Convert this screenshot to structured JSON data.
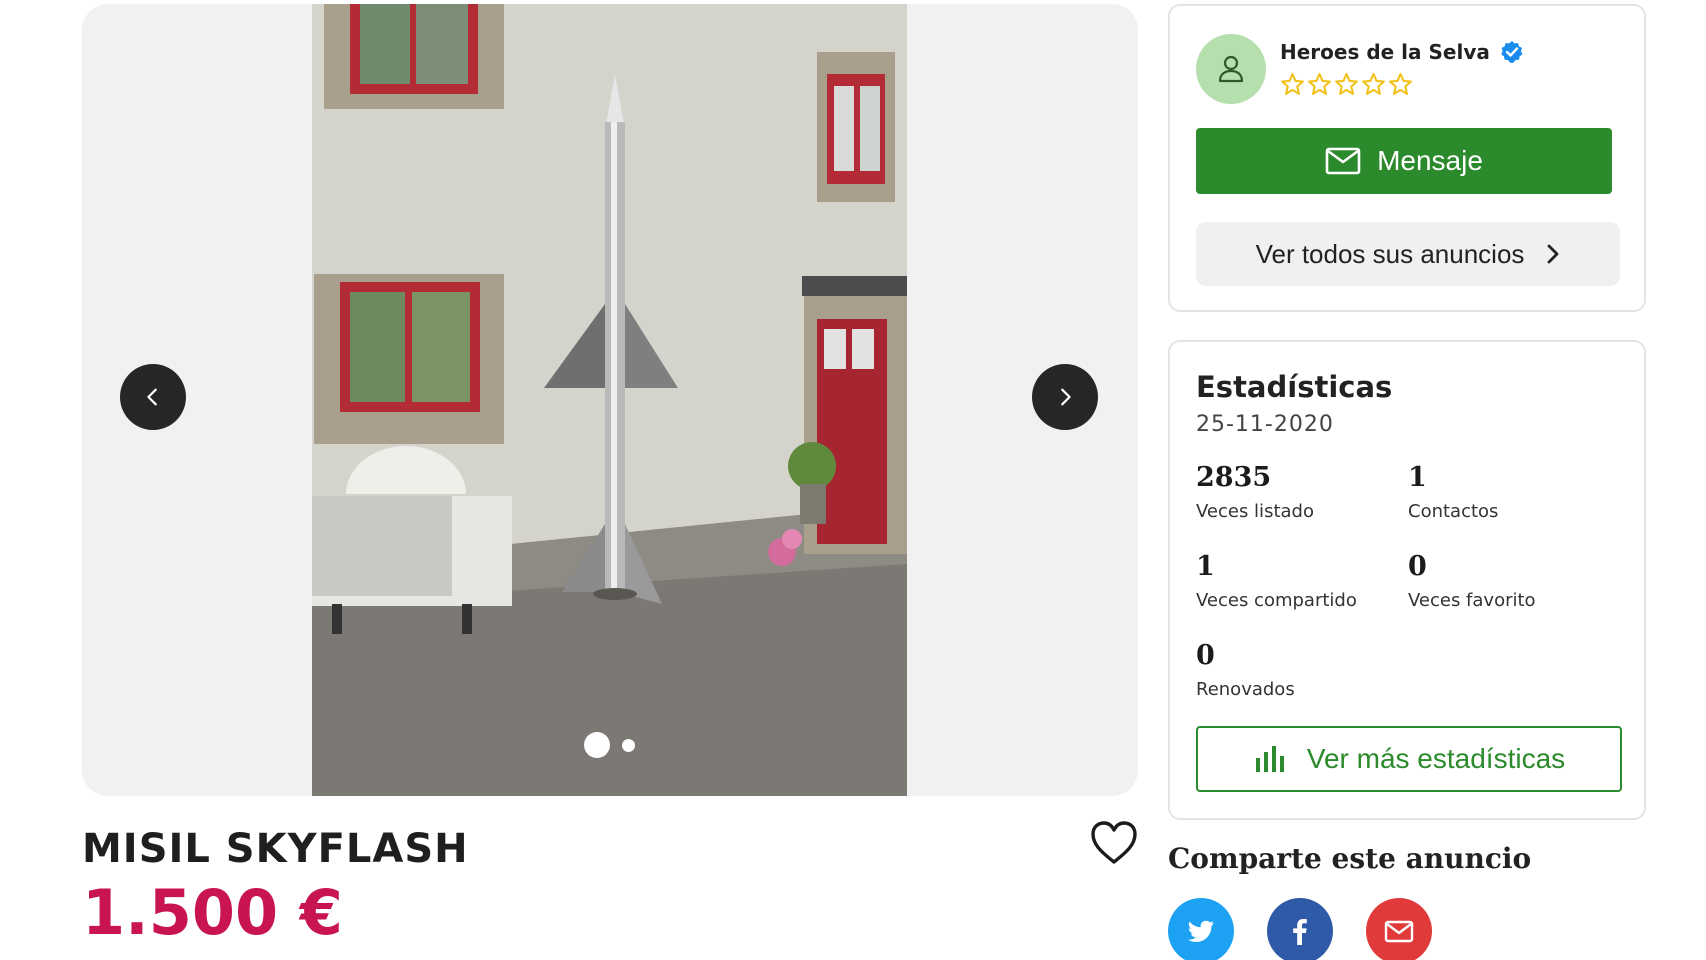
{
  "gallery": {
    "image_alt": "Misil metálico frente a una casa",
    "prev_icon": "chevron-left-icon",
    "next_icon": "chevron-right-icon",
    "total_images": 2,
    "current_image": 1
  },
  "listing": {
    "title": "MISIL SKYFLASH",
    "price": "1.500 €",
    "favorite_icon": "heart-icon"
  },
  "seller": {
    "name": "Heroes de la Selva",
    "verified": true,
    "rating": 0,
    "max_rating": 5,
    "message_label": "Mensaje",
    "all_ads_label": "Ver todos sus anuncios"
  },
  "stats": {
    "title": "Estadísticas",
    "date": "25-11-2020",
    "items": [
      {
        "value": "2835",
        "label": "Veces listado"
      },
      {
        "value": "1",
        "label": "Contactos"
      },
      {
        "value": "1",
        "label": "Veces compartido"
      },
      {
        "value": "0",
        "label": "Veces favorito"
      },
      {
        "value": "0",
        "label": "Renovados"
      }
    ],
    "more_label": "Ver más estadísticas"
  },
  "share": {
    "title": "Comparte este anuncio",
    "buttons": [
      "twitter-icon",
      "facebook-icon",
      "mail-icon"
    ]
  },
  "colors": {
    "accent_green": "#2b8a2b",
    "price_red": "#c8154f",
    "star_yellow": "#f2c21b",
    "verified_blue": "#1a8cef"
  }
}
